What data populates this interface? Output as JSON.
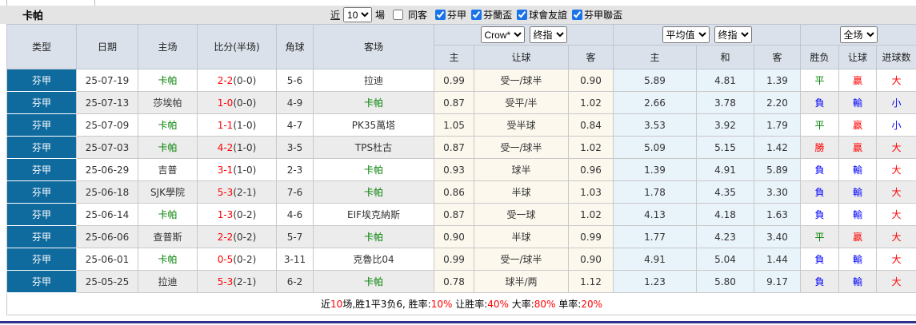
{
  "toolbar": {
    "title": "卡帕",
    "recent_label": "近",
    "recent_value": "10",
    "matches_label": "場",
    "same_away_label": "同客",
    "same_away_checked": false,
    "leagues": [
      {
        "label": "芬甲",
        "checked": true
      },
      {
        "label": "芬蘭盃",
        "checked": true
      },
      {
        "label": "球會友誼",
        "checked": true
      },
      {
        "label": "芬甲聯盃",
        "checked": true
      }
    ]
  },
  "selects": {
    "bookmaker": "Crow*",
    "final1": "终指",
    "avg": "平均值",
    "final2": "终指",
    "scope": "全场"
  },
  "header": {
    "type": "类型",
    "date": "日期",
    "home": "主场",
    "score": "比分(半场)",
    "corner": "角球",
    "away": "客场",
    "sub_home": "主",
    "sub_handicap": "让球",
    "sub_away": "客",
    "sub_avg_home": "主",
    "sub_avg_draw": "和",
    "sub_avg_away": "客",
    "sub_result": "胜负",
    "sub_handicap_result": "让球",
    "sub_goals": "进球数"
  },
  "colors": {
    "league_cell_bg": "#0f6a9e",
    "team_highlight": "#008000",
    "score": "#ff0000",
    "win": "#ff0000",
    "draw": "#008000",
    "loss": "#0000ff",
    "big": "#ff0000",
    "small": "#0000ff"
  },
  "result_color_map": {
    "勝": "#ff0000",
    "平": "#008000",
    "負": "#0000ff",
    "贏": "#ff0000",
    "輸": "#0000ff",
    "大": "#ff0000",
    "小": "#0000ff"
  },
  "highlight_team": "卡帕",
  "rows": [
    {
      "league": "芬甲",
      "date": "25-07-19",
      "home": "卡帕",
      "score": "2-2",
      "half": "(0-0)",
      "corner": "5-6",
      "away": "拉迪",
      "crow_home": "0.99",
      "handicap": "受一/球半",
      "crow_away": "0.90",
      "avg_home": "5.89",
      "avg_draw": "4.81",
      "avg_away": "1.39",
      "result": "平",
      "handicap_result": "贏",
      "goals_result": "大"
    },
    {
      "league": "芬甲",
      "date": "25-07-13",
      "home": "莎埃帕",
      "score": "1-0",
      "half": "(0-0)",
      "corner": "4-9",
      "away": "卡帕",
      "crow_home": "0.87",
      "handicap": "受平/半",
      "crow_away": "1.02",
      "avg_home": "2.66",
      "avg_draw": "3.78",
      "avg_away": "2.20",
      "result": "負",
      "handicap_result": "輸",
      "goals_result": "小"
    },
    {
      "league": "芬甲",
      "date": "25-07-09",
      "home": "卡帕",
      "score": "1-1",
      "half": "(1-0)",
      "corner": "4-7",
      "away": "PK35萬塔",
      "crow_home": "1.05",
      "handicap": "受半球",
      "crow_away": "0.84",
      "avg_home": "3.53",
      "avg_draw": "3.92",
      "avg_away": "1.79",
      "result": "平",
      "handicap_result": "贏",
      "goals_result": "小"
    },
    {
      "league": "芬甲",
      "date": "25-07-03",
      "home": "卡帕",
      "score": "4-2",
      "half": "(1-0)",
      "corner": "3-5",
      "away": "TPS杜古",
      "crow_home": "0.87",
      "handicap": "受一/球半",
      "crow_away": "1.02",
      "avg_home": "5.09",
      "avg_draw": "5.15",
      "avg_away": "1.42",
      "result": "勝",
      "handicap_result": "贏",
      "goals_result": "大"
    },
    {
      "league": "芬甲",
      "date": "25-06-29",
      "home": "吉普",
      "score": "3-1",
      "half": "(1-0)",
      "corner": "2-3",
      "away": "卡帕",
      "crow_home": "0.93",
      "handicap": "球半",
      "crow_away": "0.96",
      "avg_home": "1.39",
      "avg_draw": "4.91",
      "avg_away": "5.89",
      "result": "負",
      "handicap_result": "輸",
      "goals_result": "大"
    },
    {
      "league": "芬甲",
      "date": "25-06-18",
      "home": "SJK學院",
      "score": "5-3",
      "half": "(2-1)",
      "corner": "7-6",
      "away": "卡帕",
      "crow_home": "0.86",
      "handicap": "半球",
      "crow_away": "1.03",
      "avg_home": "1.78",
      "avg_draw": "4.35",
      "avg_away": "3.30",
      "result": "負",
      "handicap_result": "輸",
      "goals_result": "大"
    },
    {
      "league": "芬甲",
      "date": "25-06-14",
      "home": "卡帕",
      "score": "1-3",
      "half": "(0-2)",
      "corner": "4-6",
      "away": "EIF埃克納斯",
      "crow_home": "0.87",
      "handicap": "受一球",
      "crow_away": "1.02",
      "avg_home": "4.13",
      "avg_draw": "4.18",
      "avg_away": "1.63",
      "result": "負",
      "handicap_result": "輸",
      "goals_result": "大"
    },
    {
      "league": "芬甲",
      "date": "25-06-06",
      "home": "查普斯",
      "score": "2-2",
      "half": "(0-2)",
      "corner": "5-7",
      "away": "卡帕",
      "crow_home": "0.90",
      "handicap": "半球",
      "crow_away": "0.99",
      "avg_home": "1.77",
      "avg_draw": "4.23",
      "avg_away": "3.40",
      "result": "平",
      "handicap_result": "贏",
      "goals_result": "大"
    },
    {
      "league": "芬甲",
      "date": "25-06-01",
      "home": "卡帕",
      "score": "0-5",
      "half": "(0-2)",
      "corner": "3-11",
      "away": "克魯比04",
      "crow_home": "0.99",
      "handicap": "受一/球半",
      "crow_away": "0.90",
      "avg_home": "4.91",
      "avg_draw": "5.04",
      "avg_away": "1.44",
      "result": "負",
      "handicap_result": "輸",
      "goals_result": "大"
    },
    {
      "league": "芬甲",
      "date": "25-05-25",
      "home": "拉迪",
      "score": "5-3",
      "half": "(2-1)",
      "corner": "6-2",
      "away": "卡帕",
      "crow_home": "0.78",
      "handicap": "球半/两",
      "crow_away": "1.12",
      "avg_home": "1.23",
      "avg_draw": "5.80",
      "avg_away": "9.17",
      "result": "負",
      "handicap_result": "輸",
      "goals_result": "大"
    }
  ],
  "summary": {
    "parts": [
      {
        "text": "近",
        "red": false
      },
      {
        "text": "10",
        "red": true
      },
      {
        "text": "场,胜1平3负6, 胜率:",
        "red": false
      },
      {
        "text": "10%",
        "red": true
      },
      {
        "text": " 让胜率:",
        "red": false
      },
      {
        "text": "40%",
        "red": true
      },
      {
        "text": " 大率:",
        "red": false
      },
      {
        "text": "80%",
        "red": true
      },
      {
        "text": " 单率:",
        "red": false
      },
      {
        "text": "20%",
        "red": true
      }
    ]
  }
}
